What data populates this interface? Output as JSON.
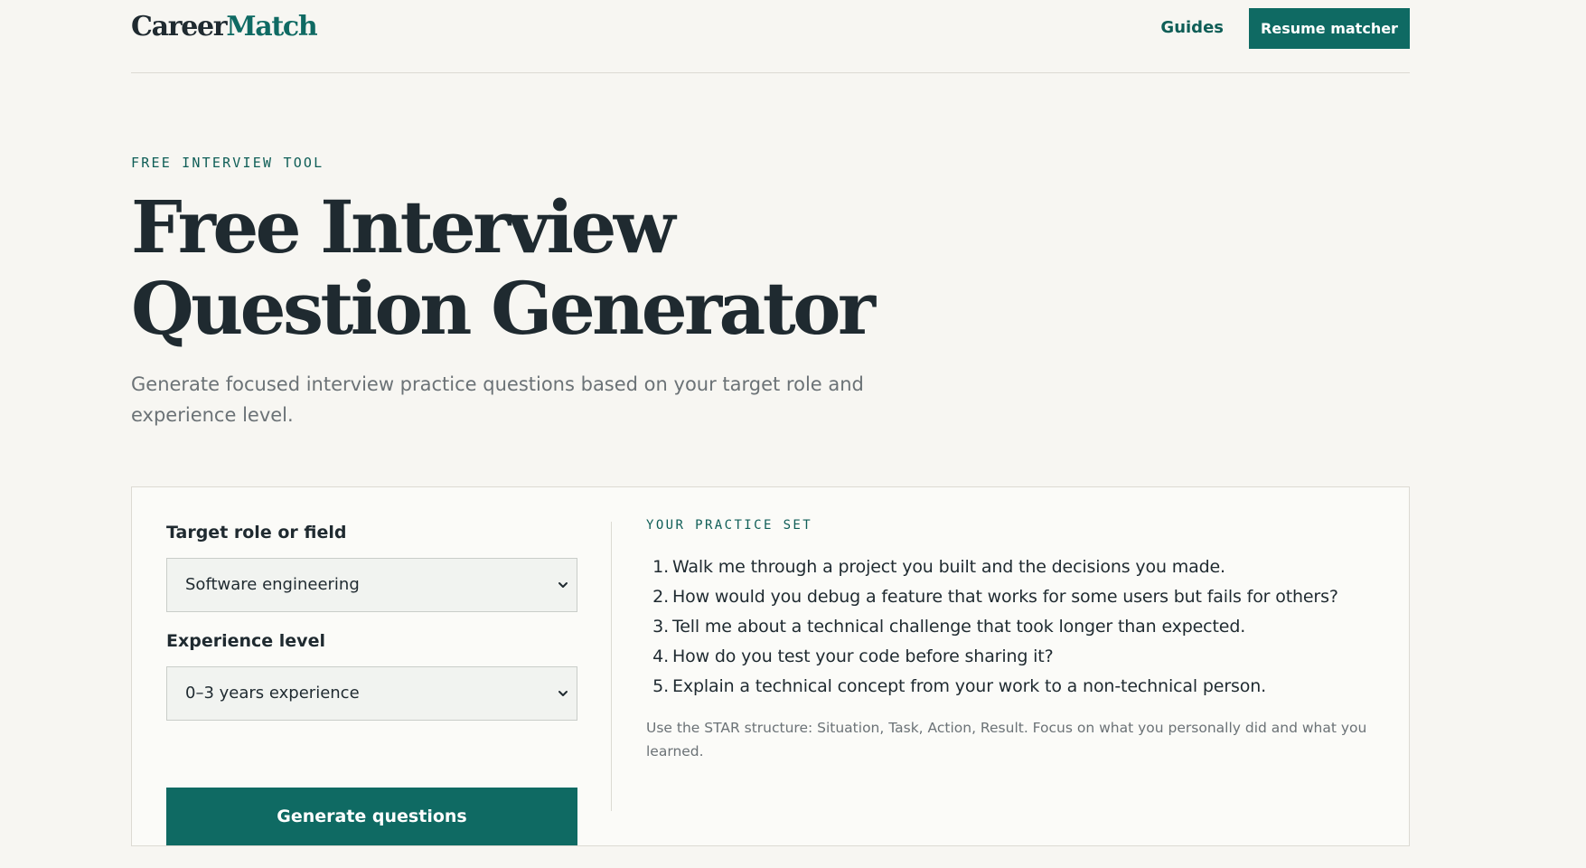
{
  "header": {
    "logo_part1": "Career",
    "logo_part2": "Match",
    "nav_guides": "Guides",
    "nav_cta": "Resume matcher"
  },
  "hero": {
    "eyebrow": "FREE INTERVIEW TOOL",
    "title": "Free Interview Question Generator",
    "subtitle": "Generate focused interview practice questions based on your target role and experience level."
  },
  "form": {
    "role_label": "Target role or field",
    "role_value": "Software engineering",
    "experience_label": "Experience level",
    "experience_value": "0–3 years experience",
    "submit_label": "Generate questions"
  },
  "results": {
    "eyebrow": "YOUR PRACTICE SET",
    "questions": [
      {
        "num": "1.",
        "text": "Walk me through a project you built and the decisions you made."
      },
      {
        "num": "2.",
        "text": "How would you debug a feature that works for some users but fails for others?"
      },
      {
        "num": "3.",
        "text": "Tell me about a technical challenge that took longer than expected."
      },
      {
        "num": "4.",
        "text": "How do you test your code before sharing it?"
      },
      {
        "num": "5.",
        "text": "Explain a technical concept from your work to a non-technical person."
      }
    ],
    "tip": "Use the STAR structure: Situation, Task, Action, Result. Focus on what you personally did and what you learned."
  },
  "icons": {
    "select_chevron": "chevron-down-icon"
  },
  "colors": {
    "brand": "#0f6a63",
    "background": "#f7f6f2",
    "text": "#1f2a30",
    "muted": "#6b7276"
  }
}
